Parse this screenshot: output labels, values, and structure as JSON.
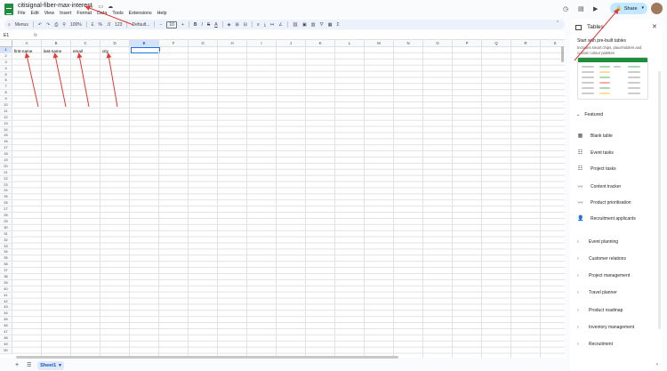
{
  "document": {
    "title": "citisignal-fiber-max-interest"
  },
  "menu": [
    "File",
    "Edit",
    "View",
    "Insert",
    "Format",
    "Data",
    "Tools",
    "Extensions",
    "Help"
  ],
  "share": {
    "label": "Share"
  },
  "toolbar": {
    "menus_label": "Menus",
    "zoom": "100%",
    "currency": "£",
    "percent": "%",
    "format_123": "123",
    "font": "Default...",
    "font_size": "10"
  },
  "formula_bar": {
    "name_box": "E1",
    "fx": "fx"
  },
  "columns": [
    "A",
    "B",
    "C",
    "D",
    "E",
    "F",
    "G",
    "H",
    "I",
    "J",
    "K",
    "L",
    "M",
    "N",
    "O",
    "P",
    "Q",
    "R",
    "S"
  ],
  "row_numbers": [
    "1",
    "2",
    "3",
    "4",
    "5",
    "6",
    "7",
    "8",
    "9",
    "10",
    "11",
    "12",
    "13",
    "14",
    "15",
    "16",
    "17",
    "18",
    "19",
    "20",
    "21",
    "22",
    "23",
    "24",
    "25",
    "26",
    "27",
    "28",
    "29",
    "30",
    "31",
    "32",
    "33",
    "34",
    "35",
    "36",
    "37",
    "38",
    "39",
    "40",
    "41",
    "42",
    "43",
    "44",
    "45",
    "46",
    "47",
    "48",
    "49",
    "50"
  ],
  "row1": {
    "a": "first-name",
    "b": "last-name",
    "c": "email",
    "d": "city"
  },
  "sheet": {
    "name": "Sheet1"
  },
  "panel": {
    "title": "Tables",
    "promo_title": "Start with pre-built tables",
    "promo_text": "Includes smart chips, placeholders and custom colour palettes",
    "featured_label": "Featured",
    "templates": [
      "Blank table",
      "Event tasks",
      "Project tasks",
      "Content tracker",
      "Product prioritisation",
      "Recruitment applicants"
    ],
    "categories": [
      "Event planning",
      "Customer relations",
      "Project management",
      "Travel planner",
      "Product roadmap",
      "Inventory management",
      "Recruitment"
    ]
  },
  "colors": {
    "accent": "#1a73e8",
    "share_bg": "#c2e7ff",
    "sheets_green": "#1e8e3e",
    "annotation_red": "#e53935"
  }
}
